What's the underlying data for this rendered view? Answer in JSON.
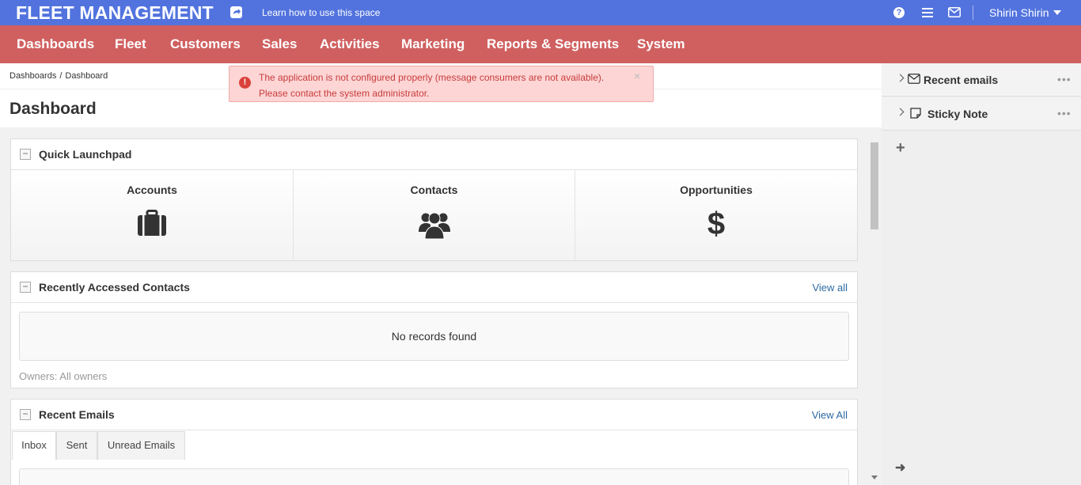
{
  "app": {
    "title": "FLEET MANAGEMENT",
    "learn_link": "Learn how to use this space",
    "user_name": "Shirin Shirin",
    "help_glyph": "?"
  },
  "nav": {
    "items": [
      "Dashboards",
      "Fleet",
      "Customers",
      "Sales",
      "Activities",
      "Marketing",
      "Reports & Segments",
      "System"
    ]
  },
  "breadcrumb": {
    "items": [
      "Dashboards",
      "Dashboard"
    ],
    "separator": "/"
  },
  "page": {
    "title": "Dashboard"
  },
  "alert": {
    "icon": "exclamation-circle-icon",
    "icon_glyph": "!",
    "message": "The application is not configured properly (message consumers are not available). Please contact the system administrator.",
    "close_glyph": "×",
    "color": "#c83c3c"
  },
  "widgets": {
    "quick_launchpad": {
      "title": "Quick Launchpad",
      "collapse_glyph": "−",
      "items": [
        {
          "label": "Accounts",
          "icon": "briefcase-icon"
        },
        {
          "label": "Contacts",
          "icon": "users-icon"
        },
        {
          "label": "Opportunities",
          "icon": "dollar-icon",
          "glyph": "$"
        }
      ]
    },
    "recent_contacts": {
      "title": "Recently Accessed Contacts",
      "collapse_glyph": "−",
      "link": "View all",
      "empty_message": "No records found",
      "owners": "Owners: All owners"
    },
    "recent_emails": {
      "title": "Recent Emails",
      "collapse_glyph": "−",
      "link": "View All",
      "tabs": [
        "Inbox",
        "Sent",
        "Unread Emails"
      ],
      "active_tab": "Inbox"
    }
  },
  "sidebar": {
    "items": [
      {
        "label": "Recent emails",
        "icon": "envelope-icon",
        "more": "•••"
      },
      {
        "label": "Sticky Note",
        "icon": "note-icon",
        "more": "•••"
      }
    ],
    "add_glyph": "+",
    "arrow_glyph": "➜"
  },
  "colors": {
    "topbar": "#5273de",
    "navbar": "#d06060",
    "link": "#2d6aa3"
  }
}
